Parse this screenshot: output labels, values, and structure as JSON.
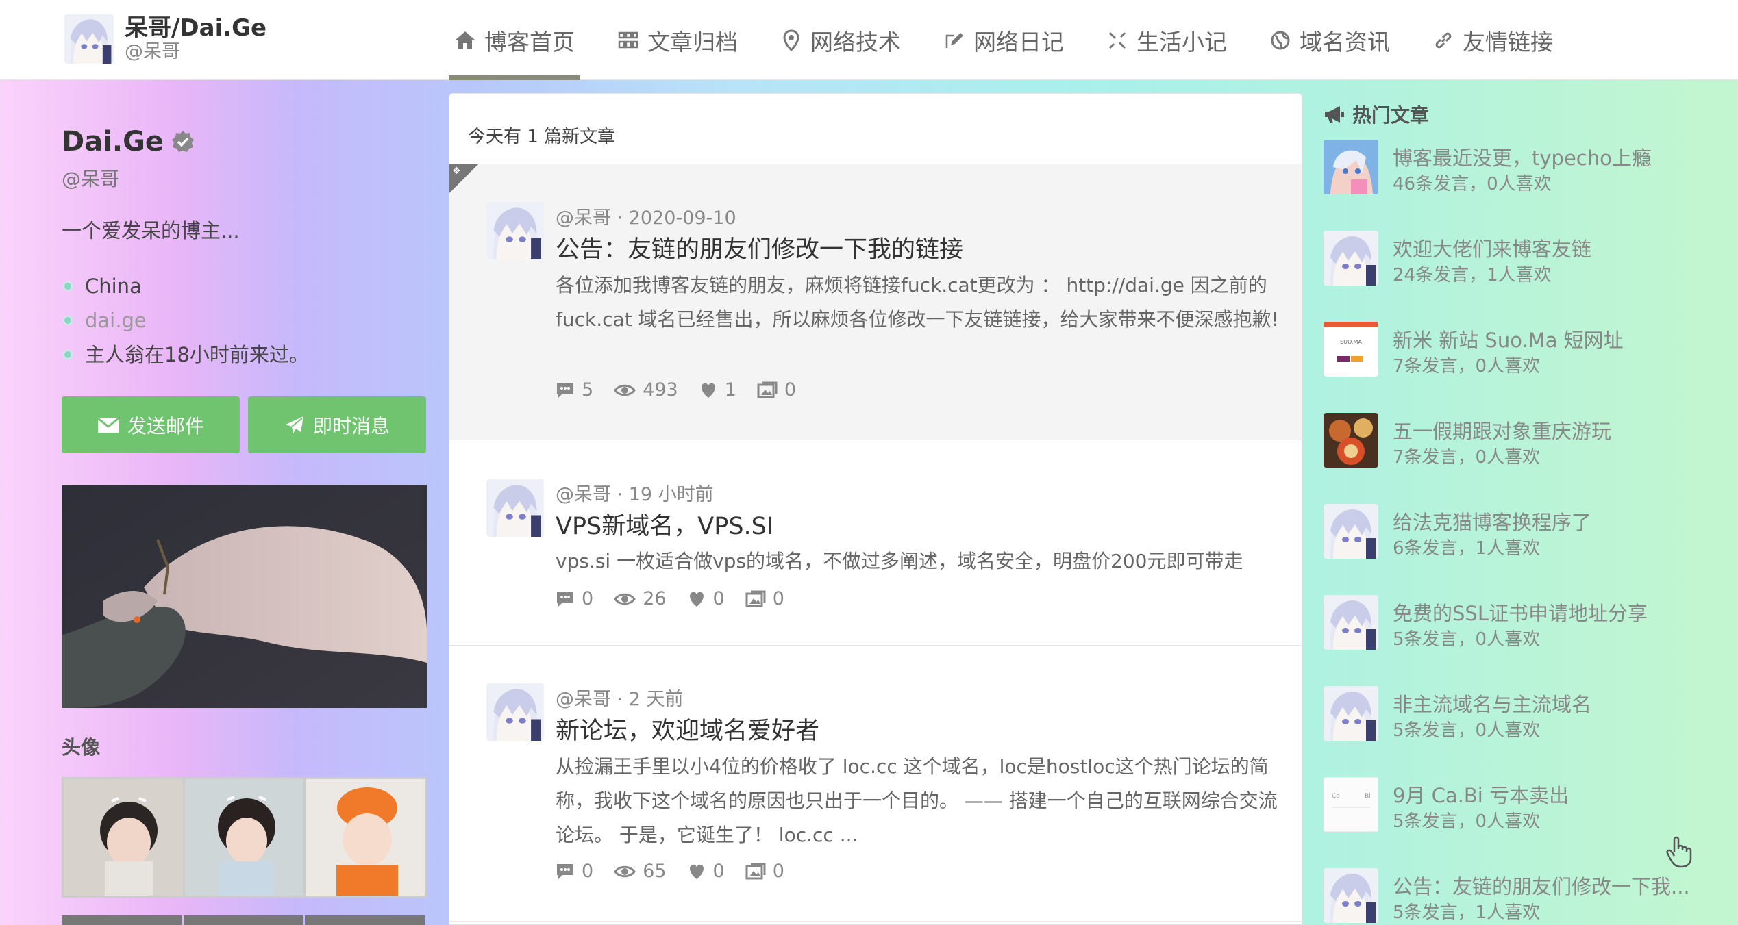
{
  "header": {
    "brand_title": "呆哥/Dai.Ge",
    "brand_sub": "@呆哥",
    "nav": [
      {
        "label": "博客首页",
        "icon": "home-icon",
        "active": true
      },
      {
        "label": "文章归档",
        "icon": "grid-icon"
      },
      {
        "label": "网络技术",
        "icon": "map-pin-icon"
      },
      {
        "label": "网络日记",
        "icon": "edit-icon"
      },
      {
        "label": "生活小记",
        "icon": "expand-icon"
      },
      {
        "label": "域名资讯",
        "icon": "globe-icon"
      },
      {
        "label": "友情链接",
        "icon": "link-icon"
      }
    ]
  },
  "profile": {
    "name": "Dai.Ge",
    "handle": "@呆哥",
    "bio": "一个爱发呆的博主...",
    "location": "China",
    "website": "dai.ge",
    "last_seen": "主人翁在18小时前来过。",
    "email_button": "发送邮件",
    "message_button": "即时消息",
    "avatar_section": "头像"
  },
  "main": {
    "today_notice": "今天有 1 篇新文章",
    "posts": [
      {
        "pinned": true,
        "meta": "@呆哥 · 2020-09-10",
        "title": "公告：友链的朋友们修改一下我的链接",
        "excerpt": "各位添加我博客友链的朋友，麻烦将链接fuck.cat更改为 ： http://dai.ge 因之前的 fuck.cat 域名已经售出，所以麻烦各位修改一下友链链接，给大家带来不便深感抱歉!",
        "comments": "5",
        "views": "493",
        "likes": "1",
        "images": "0"
      },
      {
        "pinned": false,
        "meta": "@呆哥 · 19 小时前",
        "title": "VPS新域名，VPS.SI",
        "excerpt": "vps.si 一枚适合做vps的域名，不做过多阐述，域名安全，明盘价200元即可带走",
        "comments": "0",
        "views": "26",
        "likes": "0",
        "images": "0"
      },
      {
        "pinned": false,
        "meta": "@呆哥 · 2 天前",
        "title": "新论坛，欢迎域名爱好者",
        "excerpt": "从捡漏王手里以小4位的价格收了 loc.cc 这个域名，loc是hostloc这个热门论坛的简称，我收下这个域名的原因也只出于一个目的。 —— 搭建一个自己的互联网综合交流论坛。 于是，它诞生了！ loc.cc ...",
        "comments": "0",
        "views": "65",
        "likes": "0",
        "images": "0"
      }
    ]
  },
  "hot": {
    "title": "热门文章",
    "items": [
      {
        "name": "博客最近没更，typecho上瘾",
        "sub": "46条发言，0人喜欢",
        "thumb": "anime"
      },
      {
        "name": "欢迎大佬们来博客友链",
        "sub": "24条发言，1人喜欢",
        "thumb": "avatar"
      },
      {
        "name": "新米 新站 Suo.Ma 短网址",
        "sub": "7条发言，0人喜欢",
        "thumb": "site"
      },
      {
        "name": "五一假期跟对象重庆游玩",
        "sub": "7条发言，0人喜欢",
        "thumb": "food"
      },
      {
        "name": "给法克猫博客换程序了",
        "sub": "6条发言，1人喜欢",
        "thumb": "avatar"
      },
      {
        "name": "免费的SSL证书申请地址分享",
        "sub": "5条发言，0人喜欢",
        "thumb": "avatar"
      },
      {
        "name": "非主流域名与主流域名",
        "sub": "5条发言，0人喜欢",
        "thumb": "avatar"
      },
      {
        "name": "9月 Ca.Bi 亏本卖出",
        "sub": "5条发言，0人喜欢",
        "thumb": "doc"
      },
      {
        "name": "公告：友链的朋友们修改一下我...",
        "sub": "5条发言，1人喜欢",
        "thumb": "avatar"
      }
    ]
  },
  "colors": {
    "accent_green": "#70c46f",
    "nav_active_bar": "#8a8a7a"
  }
}
